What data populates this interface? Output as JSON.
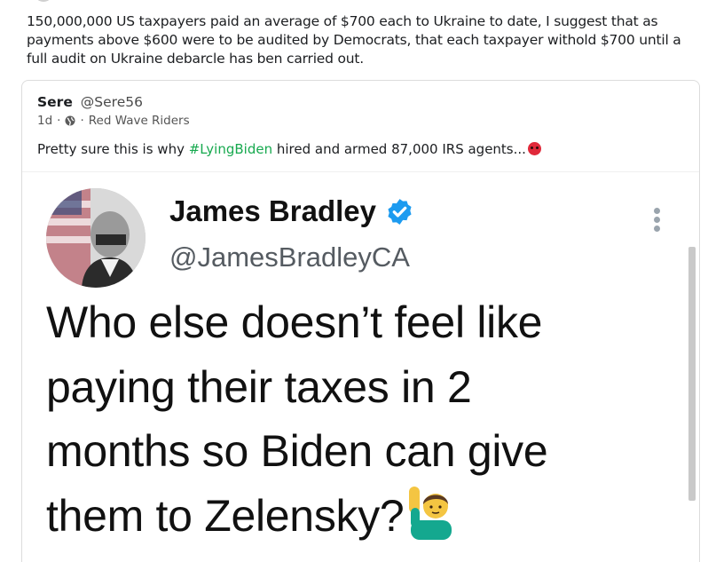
{
  "post": {
    "text": "150,000,000 US taxpayers paid an average of $700 each to Ukraine to date, I suggest that as payments above $600 were to be audited by Democrats, that each taxpayer withold $700 until a full audit on Ukraine debarcle has ben carried out."
  },
  "shared": {
    "author_name": "Sere",
    "author_handle": "@Sere56",
    "time": "1d",
    "separator": "·",
    "privacy_icon": "globe-icon",
    "group_separator": "·",
    "group_name": "Red Wave Riders",
    "body_before": "Pretty sure this is why ",
    "hashtag": "#LyingBiden",
    "body_after": " hired and armed 87,000 IRS agents...",
    "emoji": "angry-face-icon"
  },
  "tweet_image": {
    "name": "James Bradley",
    "handle": "@JamesBradleyCA",
    "verified_icon": "verified-badge-icon",
    "more_icon": "more-vertical-icon",
    "lines": [
      "Who else doesn’t feel like",
      "paying their taxes in 2",
      "months so Biden can give",
      "them to Zelensky?"
    ],
    "emoji": "person-raising-hand-icon"
  },
  "colors": {
    "hashtag": "#17a94f",
    "verified": "#1d9bf0",
    "text": "#1c1e21"
  }
}
